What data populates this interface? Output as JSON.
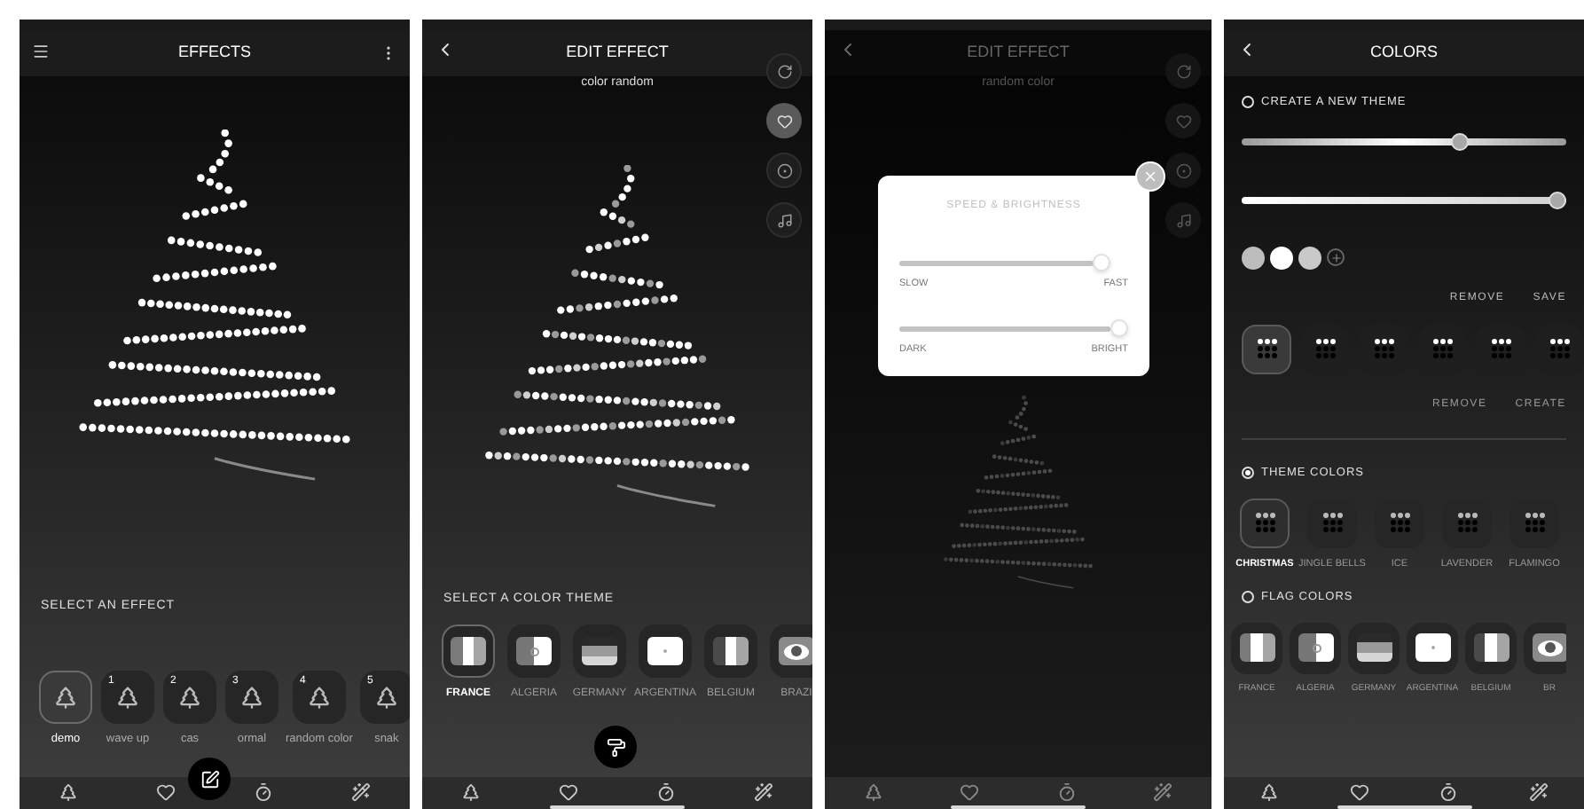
{
  "screens": [
    {
      "kind": "effects",
      "title": "EFFECTS",
      "section_label": "SELECT AN EFFECT",
      "effects": [
        {
          "label": "demo",
          "selected": true
        },
        {
          "number": "1",
          "label": "wave up",
          "selected": false
        },
        {
          "number": "2",
          "label": "cas",
          "selected": false
        },
        {
          "number": "3",
          "label": "ormal",
          "selected": false
        },
        {
          "number": "4",
          "label": "random color",
          "selected": false
        },
        {
          "number": "5",
          "label": "snak",
          "selected": false
        }
      ]
    },
    {
      "kind": "edit",
      "title": "EDIT EFFECT",
      "subtitle": "color random",
      "home_indicator": true,
      "side_buttons": [
        {
          "kind": "reset",
          "selected": false
        },
        {
          "kind": "favorite",
          "selected": true
        },
        {
          "kind": "target",
          "selected": false
        },
        {
          "kind": "music",
          "selected": false
        }
      ],
      "section_label": "SELECT A COLOR THEME",
      "flags": [
        {
          "kind": "france",
          "label": "FRANCE",
          "selected": true
        },
        {
          "kind": "algeria",
          "label": "ALGERIA",
          "selected": false
        },
        {
          "kind": "germany",
          "label": "GERMANY",
          "selected": false
        },
        {
          "kind": "argentina",
          "label": "ARGENTINA",
          "selected": false
        },
        {
          "kind": "belgium",
          "label": "BELGIUM",
          "selected": false
        },
        {
          "kind": "brazil",
          "label": "BRAZI",
          "selected": false
        }
      ]
    },
    {
      "kind": "edit_dialog",
      "title": "EDIT EFFECT",
      "subtitle": "random color",
      "home_indicator": true,
      "side_buttons": [
        {
          "kind": "reset",
          "selected": false
        },
        {
          "kind": "favorite",
          "selected": false
        },
        {
          "kind": "target",
          "selected": false
        },
        {
          "kind": "music",
          "selected": false
        }
      ],
      "dialog": {
        "title": "SPEED & BRIGHTNESS",
        "sliders": [
          {
            "level": 0.92,
            "min_label": "SLOW",
            "max_label": "FAST"
          },
          {
            "level": 1,
            "min_label": "DARK",
            "max_label": "BRIGHT"
          }
        ]
      }
    },
    {
      "kind": "colors",
      "title": "COLORS",
      "home_indicator": true,
      "create": {
        "label": "CREATE A NEW THEME",
        "selected": false,
        "sliders": [
          {
            "kind": "hue",
            "level": 0.68
          },
          {
            "kind": "brightness",
            "level": 1
          }
        ],
        "swatches": [
          {
            "color": "#bdbdbd"
          },
          {
            "color": "#ffffff"
          },
          {
            "color": "#c9c9c9"
          }
        ],
        "actions": [
          "REMOVE",
          "SAVE"
        ],
        "custom_themes": [
          {
            "selected": true
          },
          {
            "selected": false
          },
          {
            "selected": false
          },
          {
            "selected": false
          },
          {
            "selected": false
          },
          {
            "selected": false
          }
        ],
        "theme_actions": [
          "REMOVE",
          "CREATE"
        ]
      },
      "theme_colors": {
        "label": "THEME COLORS",
        "selected": true,
        "items": [
          {
            "label": "CHRISTMAS",
            "selected": true
          },
          {
            "label": "JINGLE BELLS",
            "selected": false
          },
          {
            "label": "ICE",
            "selected": false
          },
          {
            "label": "LAVENDER",
            "selected": false
          },
          {
            "label": "FLAMINGO",
            "selected": false
          }
        ]
      },
      "flag_colors": {
        "label": "FLAG COLORS",
        "selected": false,
        "items": [
          {
            "kind": "france",
            "label": "FRANCE",
            "selected": false
          },
          {
            "kind": "algeria",
            "label": "ALGERIA",
            "selected": false
          },
          {
            "kind": "germany",
            "label": "GERMANY",
            "selected": false
          },
          {
            "kind": "argentina",
            "label": "ARGENTINA",
            "selected": false
          },
          {
            "kind": "belgium",
            "label": "BELGIUM",
            "selected": false
          },
          {
            "kind": "brazil",
            "label": "BR",
            "selected": false
          }
        ]
      }
    }
  ]
}
